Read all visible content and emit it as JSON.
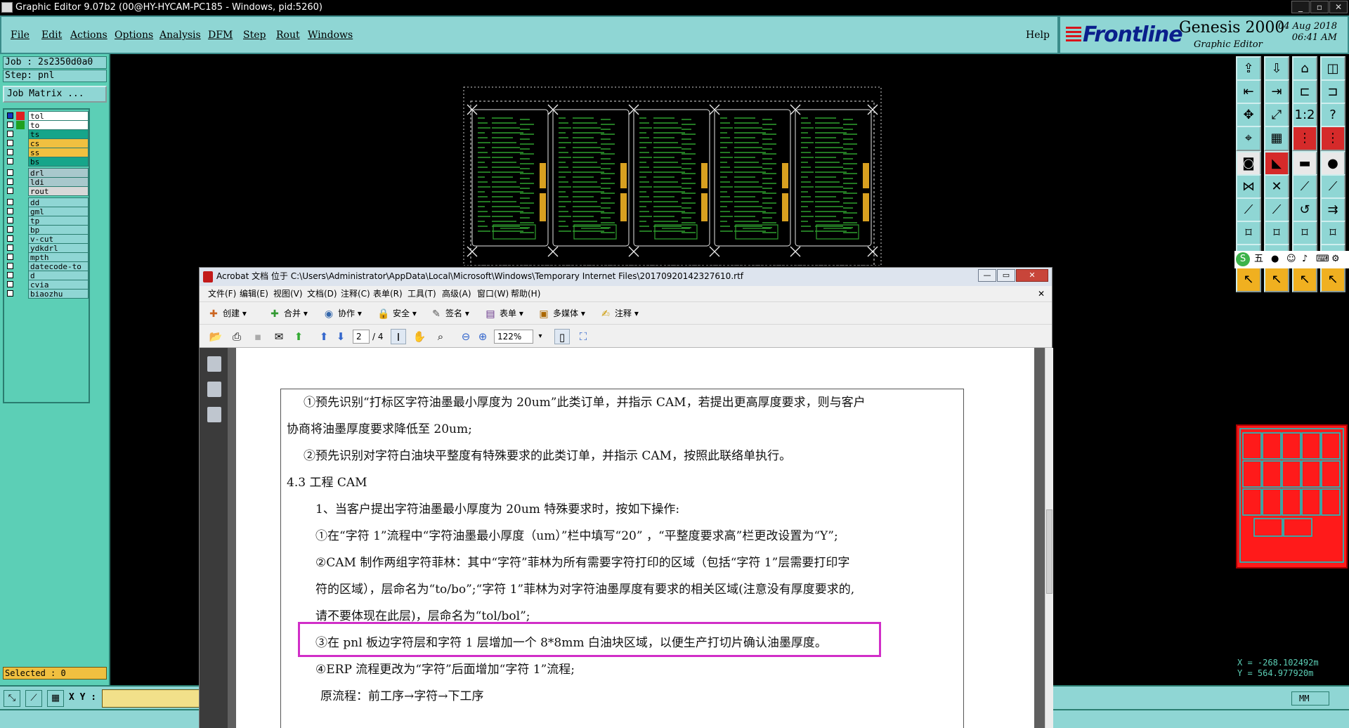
{
  "window": {
    "title": "Graphic Editor 9.07b2 (00@HY-HYCAM-PC185 - Windows, pid:5260)",
    "controls": [
      "_",
      "▫",
      "✕"
    ]
  },
  "menu": {
    "items": [
      "File",
      "Edit",
      "Actions",
      "Options",
      "Analysis",
      "DFM",
      "Step",
      "Rout",
      "Windows"
    ],
    "help": "Help"
  },
  "brand": {
    "logo": "Frontline",
    "product": "Genesis 2000",
    "subtitle": "Graphic Editor",
    "date": "04 Aug 2018",
    "time": "06:41 AM"
  },
  "job": {
    "job_line": "Job : 2s2350d0a0",
    "step_line": "Step: pnl",
    "matrix_button": "Job Matrix ..."
  },
  "layers": [
    {
      "name": "tol",
      "color": "#e02020",
      "bg": "#ffffff",
      "checked": true
    },
    {
      "name": "to",
      "color": "#20a020",
      "bg": "#ffffff",
      "checked": false
    },
    {
      "name": "ts",
      "color": "",
      "bg": "#16a58a",
      "checked": false
    },
    {
      "name": "cs",
      "color": "",
      "bg": "#f0c040",
      "checked": false
    },
    {
      "name": "ss",
      "color": "",
      "bg": "#f0c040",
      "checked": false
    },
    {
      "name": "bs",
      "color": "",
      "bg": "#16a58a",
      "checked": false
    },
    {
      "name": "drl",
      "color": "",
      "bg": "#a8c8cc",
      "checked": false
    },
    {
      "name": "ldi",
      "color": "",
      "bg": "#a8c8cc",
      "checked": false
    },
    {
      "name": "rout",
      "color": "",
      "bg": "#d8d8d8",
      "checked": false
    },
    {
      "name": "dd",
      "color": "",
      "bg": "#8fd6d4",
      "checked": false
    },
    {
      "name": "gml",
      "color": "",
      "bg": "#8fd6d4",
      "checked": false
    },
    {
      "name": "tp",
      "color": "",
      "bg": "#8fd6d4",
      "checked": false
    },
    {
      "name": "bp",
      "color": "",
      "bg": "#8fd6d4",
      "checked": false
    },
    {
      "name": "v-cut",
      "color": "",
      "bg": "#8fd6d4",
      "checked": false
    },
    {
      "name": "ydkdrl",
      "color": "",
      "bg": "#8fd6d4",
      "checked": false
    },
    {
      "name": "mpth",
      "color": "",
      "bg": "#8fd6d4",
      "checked": false
    },
    {
      "name": "datecode-to",
      "color": "",
      "bg": "#8fd6d4",
      "checked": false
    },
    {
      "name": "d",
      "color": "",
      "bg": "#8fd6d4",
      "checked": false
    },
    {
      "name": "cvia",
      "color": "",
      "bg": "#8fd6d4",
      "checked": false
    },
    {
      "name": "biaozhu",
      "color": "",
      "bg": "#8fd6d4",
      "checked": false
    }
  ],
  "status": {
    "selected": "Selected : 0",
    "xy_label": "X Y :",
    "xy_value": "",
    "units": "MM",
    "coord_x": "X = -268.102492m",
    "coord_y": "Y = 564.977920m"
  },
  "ime": {
    "label": "五"
  },
  "acrobat": {
    "title": "Acrobat 文档 位于 C:\\Users\\Administrator\\AppData\\Local\\Microsoft\\Windows\\Temporary Internet Files\\20170920142327610.rtf",
    "menu": [
      "文件(F)",
      "编辑(E)",
      "视图(V)",
      "文档(D)",
      "注释(C)",
      "表单(R)",
      "工具(T)",
      "高级(A)",
      "窗口(W)",
      "帮助(H)"
    ],
    "toolbar": [
      "创建",
      "合并",
      "协作",
      "安全",
      "签名",
      "表单",
      "多媒体",
      "注释"
    ],
    "page_current": "2",
    "page_total": "/ 4",
    "zoom": "122%",
    "doc_lines": [
      "①预先识别“打标区字符油墨最小厚度为 20um”此类订单，并指示 CAM，若提出更高厚度要求，则与客户",
      "协商将油墨厚度要求降低至 20um;",
      "②预先识别对字符白油块平整度有特殊要求的此类订单，并指示 CAM，按照此联络单执行。",
      "4.3 工程 CAM",
      "1、当客户提出字符油墨最小厚度为 20um 特殊要求时，按如下操作:",
      "①在“字符 1”流程中“字符油墨最小厚度（um）”栏中填写“20” ，“平整度要求高”栏更改设置为“Y”;",
      "②CAM 制作两组字符菲林：其中“字符”菲林为所有需要字符打印的区域（包括“字符 1”层需要打印字",
      "符的区域），层命名为“to/bo”;“字符 1”菲林为对字符油墨厚度有要求的相关区域(注意没有厚度要求的,",
      "请不要体现在此层)，层命名为“tol/bol”;",
      "③在 pnl 板边字符层和字符 1 层增加一个 8*8mm 白油块区域，以便生产打切片确认油墨厚度。",
      "④ERP 流程更改为“字符”后面增加“字符 1”流程;",
      "原流程：前工序→字符→下工序"
    ]
  },
  "colors": {
    "teal": "#8fd6d4",
    "panel": "#5ccfb6",
    "highlight": "#d12ec8",
    "minimap": "#ff1a1a",
    "pcb_trace": "#2fa02f",
    "pcb_pad": "#d8a020"
  }
}
